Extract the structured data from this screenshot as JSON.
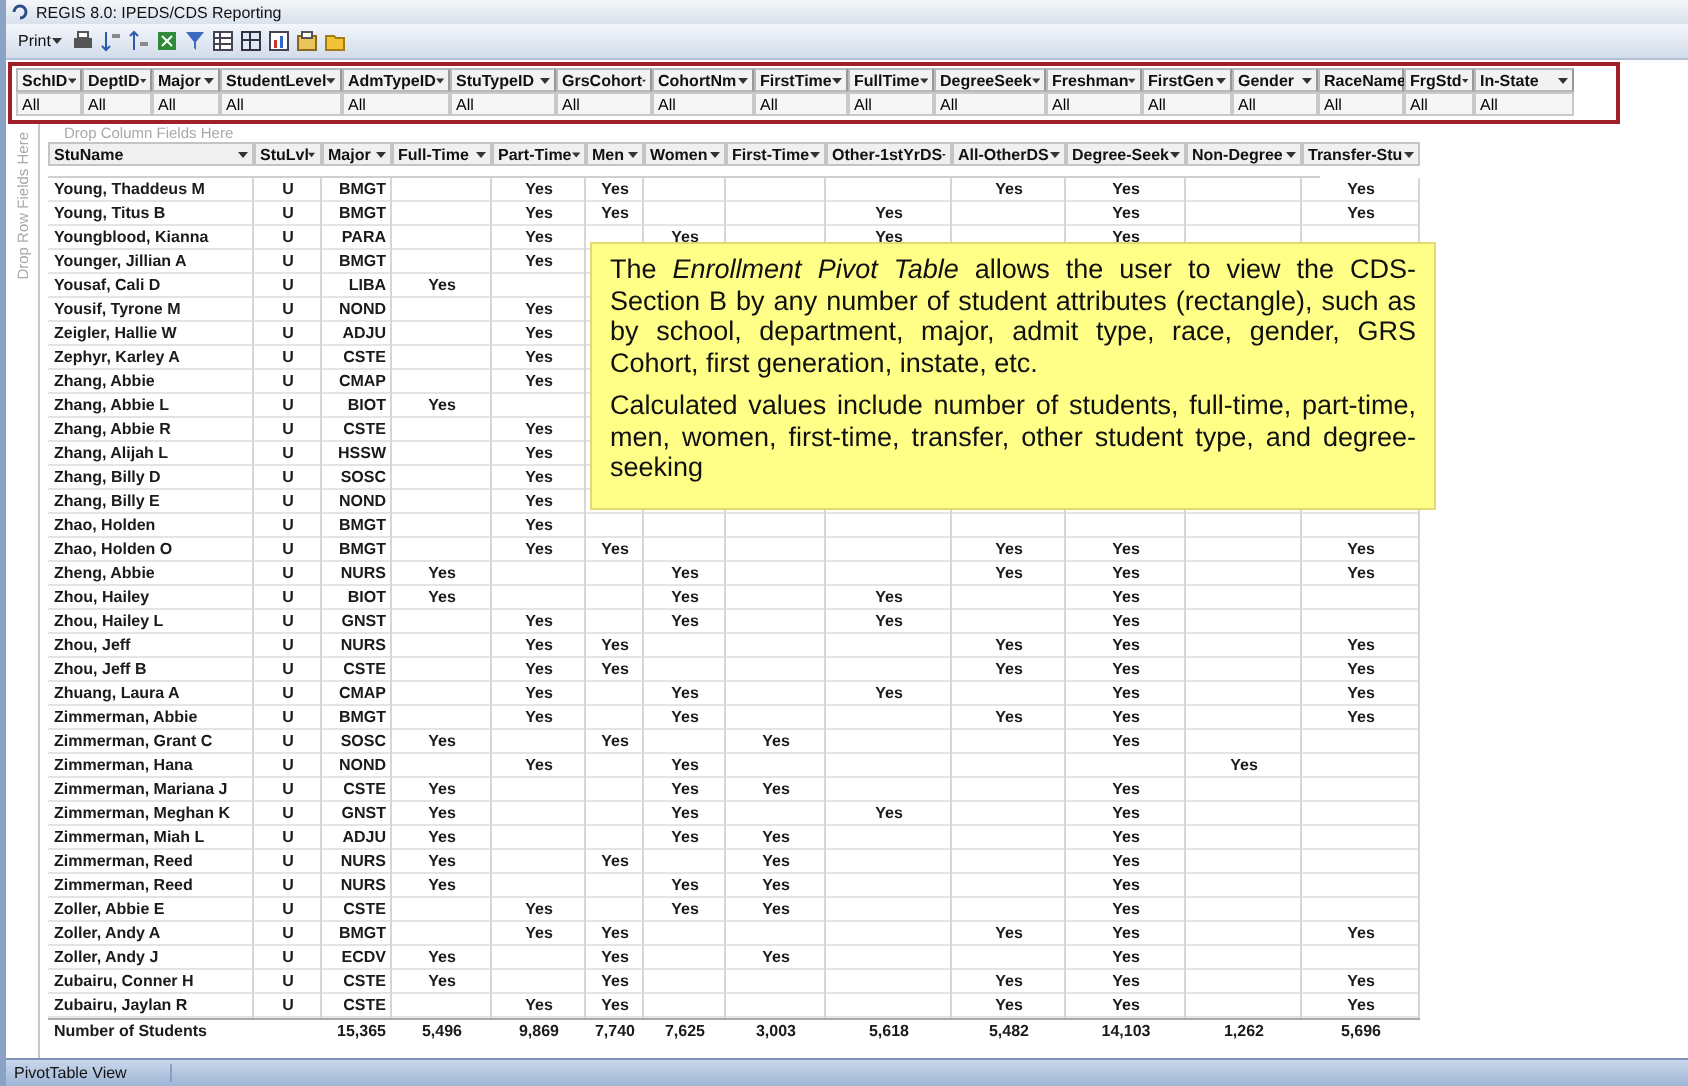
{
  "window": {
    "title": "REGIS 8.0:  IPEDS/CDS Reporting"
  },
  "toolbar": {
    "print": "Print"
  },
  "filters": [
    {
      "label": "SchID",
      "value": "All"
    },
    {
      "label": "DeptID",
      "value": "All"
    },
    {
      "label": "Major",
      "value": "All"
    },
    {
      "label": "StudentLevel",
      "value": "All"
    },
    {
      "label": "AdmTypeID",
      "value": "All"
    },
    {
      "label": "StuTypeID",
      "value": "All"
    },
    {
      "label": "GrsCohort",
      "value": "All"
    },
    {
      "label": "CohortNm",
      "value": "All"
    },
    {
      "label": "FirstTime",
      "value": "All"
    },
    {
      "label": "FullTime",
      "value": "All"
    },
    {
      "label": "DegreeSeek",
      "value": "All"
    },
    {
      "label": "Freshman",
      "value": "All"
    },
    {
      "label": "FirstGen",
      "value": "All"
    },
    {
      "label": "Gender",
      "value": "All"
    },
    {
      "label": "RaceName",
      "value": "All"
    },
    {
      "label": "FrgStd",
      "value": "All"
    },
    {
      "label": "In-State",
      "value": "All"
    }
  ],
  "column_drop_hint": "Drop Column Fields Here",
  "row_drop_hint": "Drop Row Fields Here",
  "table": {
    "columns": [
      "StuName",
      "StuLvl",
      "Major",
      "Full-Time",
      "Part-Time",
      "Men",
      "Women",
      "First-Time",
      "Other-1stYrDS",
      "All-OtherDS",
      "Degree-Seek",
      "Non-Degree",
      "Transfer-Stu"
    ],
    "rows": [
      [
        "Young, Thaddeus M",
        "U",
        "BMGT",
        null,
        "Yes",
        "Yes",
        null,
        null,
        null,
        "Yes",
        "Yes",
        null,
        "Yes"
      ],
      [
        "Young, Titus B",
        "U",
        "BMGT",
        null,
        "Yes",
        "Yes",
        null,
        null,
        "Yes",
        null,
        "Yes",
        null,
        "Yes"
      ],
      [
        "Youngblood, Kianna",
        "U",
        "PARA",
        null,
        "Yes",
        null,
        "Yes",
        null,
        "Yes",
        null,
        "Yes",
        null,
        null
      ],
      [
        "Younger, Jillian A",
        "U",
        "BMGT",
        null,
        "Yes",
        null,
        null,
        null,
        null,
        null,
        null,
        null,
        null
      ],
      [
        "Yousaf, Cali D",
        "U",
        "LIBA",
        "Yes",
        null,
        null,
        null,
        null,
        null,
        null,
        null,
        null,
        null
      ],
      [
        "Yousif, Tyrone M",
        "U",
        "NOND",
        null,
        "Yes",
        null,
        null,
        null,
        null,
        null,
        null,
        null,
        null
      ],
      [
        "Zeigler, Hallie W",
        "U",
        "ADJU",
        null,
        "Yes",
        null,
        null,
        null,
        null,
        null,
        null,
        null,
        null
      ],
      [
        "Zephyr, Karley A",
        "U",
        "CSTE",
        null,
        "Yes",
        null,
        null,
        null,
        null,
        null,
        null,
        null,
        null
      ],
      [
        "Zhang, Abbie",
        "U",
        "CMAP",
        null,
        "Yes",
        null,
        null,
        null,
        null,
        null,
        null,
        null,
        null
      ],
      [
        "Zhang, Abbie L",
        "U",
        "BIOT",
        "Yes",
        null,
        null,
        null,
        null,
        null,
        null,
        null,
        null,
        null
      ],
      [
        "Zhang, Abbie R",
        "U",
        "CSTE",
        null,
        "Yes",
        null,
        null,
        null,
        null,
        null,
        null,
        null,
        null
      ],
      [
        "Zhang, Alijah L",
        "U",
        "HSSW",
        null,
        "Yes",
        null,
        null,
        null,
        null,
        null,
        null,
        null,
        null
      ],
      [
        "Zhang, Billy D",
        "U",
        "SOSC",
        null,
        "Yes",
        null,
        null,
        null,
        null,
        null,
        null,
        null,
        null
      ],
      [
        "Zhang, Billy E",
        "U",
        "NOND",
        null,
        "Yes",
        null,
        null,
        null,
        null,
        null,
        null,
        null,
        null
      ],
      [
        "Zhao, Holden",
        "U",
        "BMGT",
        null,
        "Yes",
        null,
        null,
        null,
        null,
        null,
        null,
        null,
        null
      ],
      [
        "Zhao, Holden O",
        "U",
        "BMGT",
        null,
        "Yes",
        "Yes",
        null,
        null,
        null,
        "Yes",
        "Yes",
        null,
        "Yes"
      ],
      [
        "Zheng, Abbie",
        "U",
        "NURS",
        "Yes",
        null,
        null,
        "Yes",
        null,
        null,
        "Yes",
        "Yes",
        null,
        "Yes"
      ],
      [
        "Zhou, Hailey",
        "U",
        "BIOT",
        "Yes",
        null,
        null,
        "Yes",
        null,
        "Yes",
        null,
        "Yes",
        null,
        null
      ],
      [
        "Zhou, Hailey L",
        "U",
        "GNST",
        null,
        "Yes",
        null,
        "Yes",
        null,
        "Yes",
        null,
        "Yes",
        null,
        null
      ],
      [
        "Zhou, Jeff",
        "U",
        "NURS",
        null,
        "Yes",
        "Yes",
        null,
        null,
        null,
        "Yes",
        "Yes",
        null,
        "Yes"
      ],
      [
        "Zhou, Jeff B",
        "U",
        "CSTE",
        null,
        "Yes",
        "Yes",
        null,
        null,
        null,
        "Yes",
        "Yes",
        null,
        "Yes"
      ],
      [
        "Zhuang, Laura A",
        "U",
        "CMAP",
        null,
        "Yes",
        null,
        "Yes",
        null,
        "Yes",
        null,
        "Yes",
        null,
        "Yes"
      ],
      [
        "Zimmerman, Abbie",
        "U",
        "BMGT",
        null,
        "Yes",
        null,
        "Yes",
        null,
        null,
        "Yes",
        "Yes",
        null,
        "Yes"
      ],
      [
        "Zimmerman, Grant C",
        "U",
        "SOSC",
        "Yes",
        null,
        "Yes",
        null,
        "Yes",
        null,
        null,
        "Yes",
        null,
        null
      ],
      [
        "Zimmerman, Hana",
        "U",
        "NOND",
        null,
        "Yes",
        null,
        "Yes",
        null,
        null,
        null,
        null,
        "Yes",
        null
      ],
      [
        "Zimmerman, Mariana J",
        "U",
        "CSTE",
        "Yes",
        null,
        null,
        "Yes",
        "Yes",
        null,
        null,
        "Yes",
        null,
        null
      ],
      [
        "Zimmerman, Meghan K",
        "U",
        "GNST",
        "Yes",
        null,
        null,
        "Yes",
        null,
        "Yes",
        null,
        "Yes",
        null,
        null
      ],
      [
        "Zimmerman, Miah L",
        "U",
        "ADJU",
        "Yes",
        null,
        null,
        "Yes",
        "Yes",
        null,
        null,
        "Yes",
        null,
        null
      ],
      [
        "Zimmerman, Reed",
        "U",
        "NURS",
        "Yes",
        null,
        "Yes",
        null,
        "Yes",
        null,
        null,
        "Yes",
        null,
        null
      ],
      [
        "Zimmerman, Reed",
        "U",
        "NURS",
        "Yes",
        null,
        null,
        "Yes",
        "Yes",
        null,
        null,
        "Yes",
        null,
        null
      ],
      [
        "Zoller, Abbie E",
        "U",
        "CSTE",
        null,
        "Yes",
        null,
        "Yes",
        "Yes",
        null,
        null,
        "Yes",
        null,
        null
      ],
      [
        "Zoller, Andy A",
        "U",
        "BMGT",
        null,
        "Yes",
        "Yes",
        null,
        null,
        null,
        "Yes",
        "Yes",
        null,
        "Yes"
      ],
      [
        "Zoller, Andy J",
        "U",
        "ECDV",
        "Yes",
        null,
        "Yes",
        null,
        "Yes",
        null,
        null,
        "Yes",
        null,
        null
      ],
      [
        "Zubairu, Conner H",
        "U",
        "CSTE",
        "Yes",
        null,
        "Yes",
        null,
        null,
        null,
        "Yes",
        "Yes",
        null,
        "Yes"
      ],
      [
        "Zubairu, Jaylan R",
        "U",
        "CSTE",
        null,
        "Yes",
        "Yes",
        null,
        null,
        null,
        "Yes",
        "Yes",
        null,
        "Yes"
      ]
    ],
    "total": {
      "label": "Number of Students",
      "values": [
        "15,365",
        "5,496",
        "9,869",
        "7,740",
        "7,625",
        "3,003",
        "5,618",
        "5,482",
        "14,103",
        "1,262",
        "5,696"
      ]
    }
  },
  "callout": [
    "The *Enrollment Pivot Table* allows the user to view the CDS-Section B by any number of student attributes (rectangle), such as by school, department, major, admit type, race, gender, GRS Cohort, first generation, instate, etc.",
    "Calculated values include number of students, full-time, part-time, men, women, first-time, transfer, other student type, and degree-seeking"
  ],
  "status_bar": "PivotTable View"
}
